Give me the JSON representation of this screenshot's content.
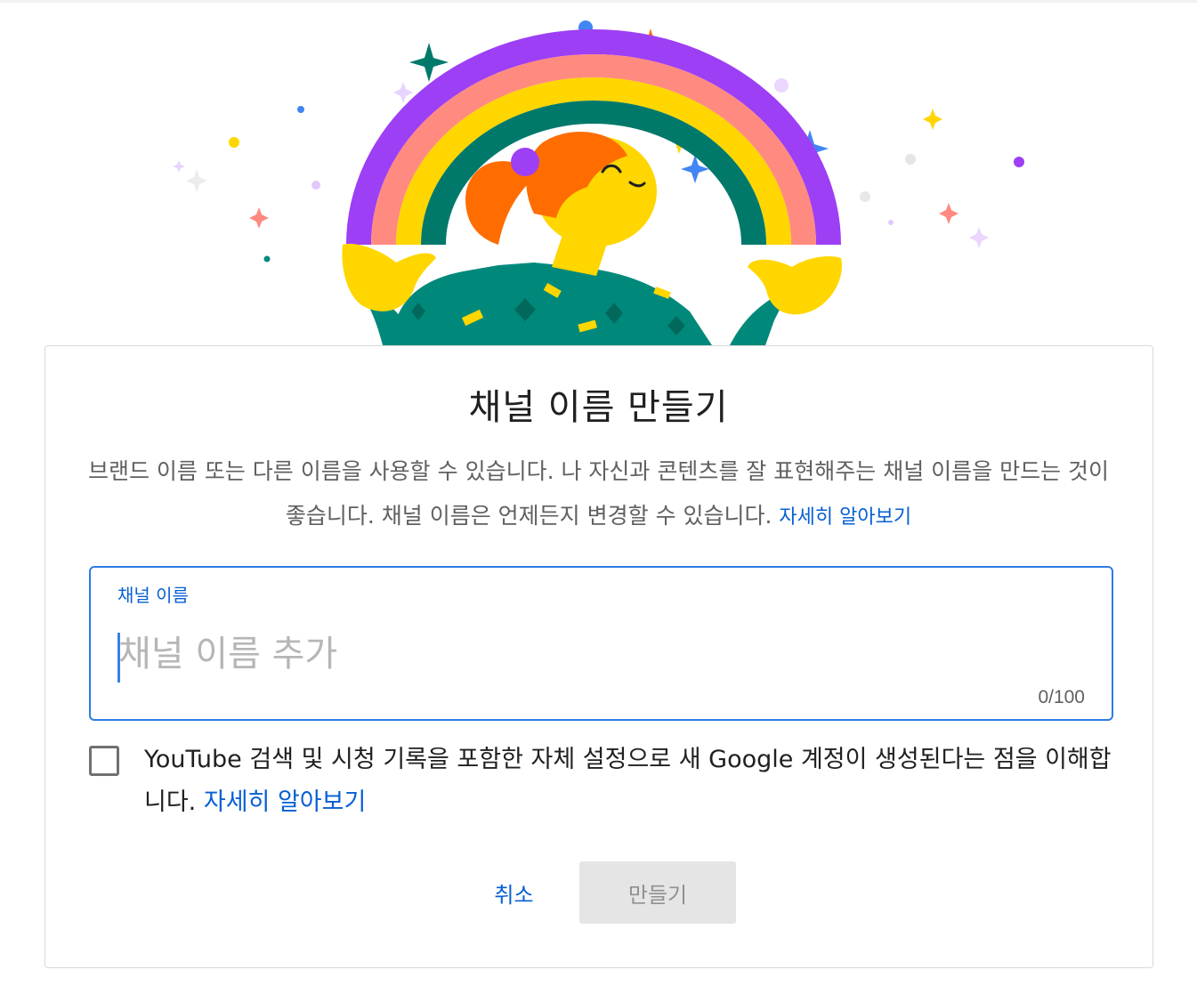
{
  "dialog": {
    "title": "채널 이름 만들기",
    "description": "브랜드 이름 또는 다른 이름을 사용할 수 있습니다. 나 자신과 콘텐츠를 잘 표현해주는 채널 이름을 만드는 것이 좋습니다. 채널 이름은 언제든지 변경할 수 있습니다.",
    "learn_more_label": "자세히 알아보기"
  },
  "channel_name_field": {
    "label": "채널 이름",
    "value": "",
    "placeholder": "채널 이름 추가",
    "counter": "0/100"
  },
  "consent": {
    "checked": false,
    "text": "YouTube 검색 및 시청 기록을 포함한 자체 설정으로 새 Google 계정이 생성된다는 점을 이해합니다.",
    "learn_more_label": "자세히 알아보기"
  },
  "actions": {
    "cancel_label": "취소",
    "create_label": "만들기",
    "create_enabled": false
  },
  "illustration": {
    "subject": "rainbow-person-illustration",
    "colors": {
      "rainbow_purple": "#9d3ff5",
      "rainbow_pink": "#ff8a80",
      "rainbow_yellow": "#ffd600",
      "rainbow_teal": "#00796b",
      "hair": "#ff6d00",
      "skin": "#ffd600",
      "shirt": "#00897b"
    }
  },
  "colors": {
    "accent_blue": "#065fd4",
    "focus_border": "#2e7be6",
    "text_primary": "#202020",
    "text_secondary": "#606060",
    "disabled_bg": "#e5e5e5"
  }
}
